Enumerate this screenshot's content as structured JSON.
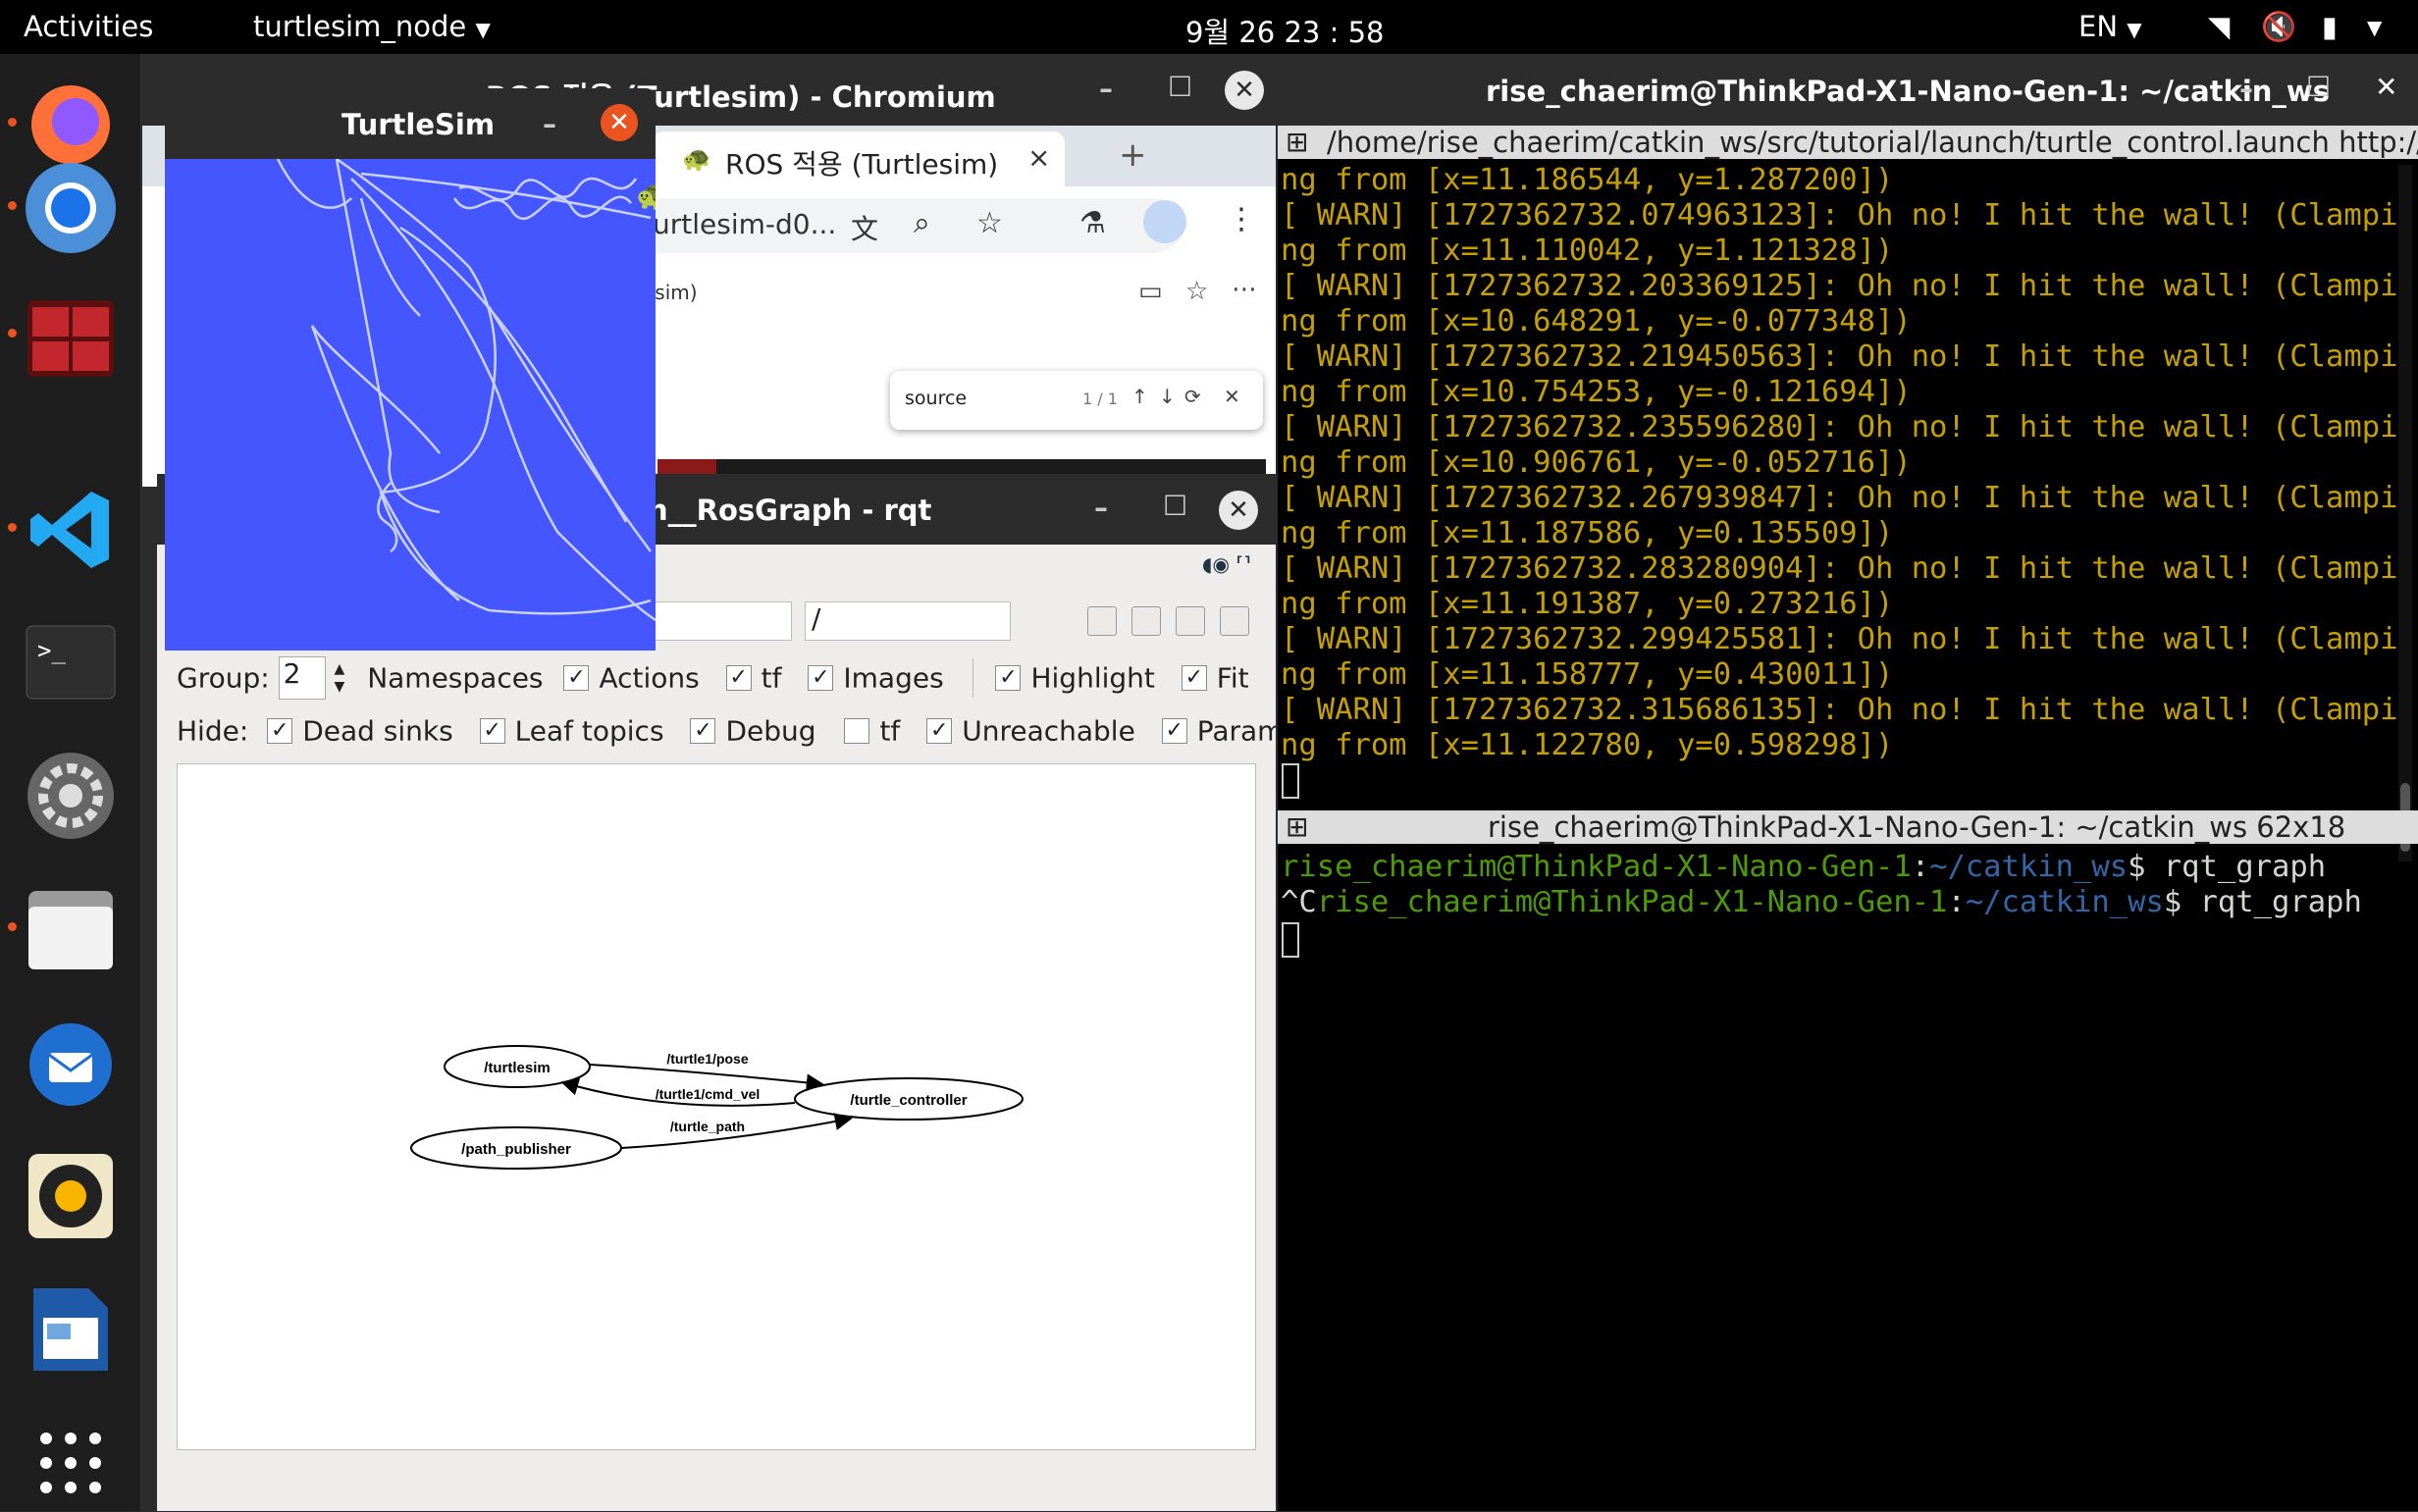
{
  "topbar": {
    "activities": "Activities",
    "app_menu": "turtlesim_node",
    "clock": "9월 26  23 : 58",
    "lang": "EN"
  },
  "dock": [
    "firefox-icon",
    "chromium-icon",
    "terminator-icon",
    "vscode-icon",
    "terminal-icon",
    "settings-icon",
    "files-icon",
    "thunderbird-icon",
    "rhythmbox-icon",
    "writer-icon",
    "show-apps-icon"
  ],
  "chromium": {
    "title": "ROS 적용 (Turtlesim) - Chromium",
    "tab": "ROS 적용 (Turtlesim)",
    "url": "urtlesim-d0...",
    "frag": "esim)",
    "find": {
      "query": "source",
      "count": "1 / 1"
    }
  },
  "turtlesim": {
    "title": "TurtleSim"
  },
  "rqt": {
    "title": "h__RosGraph - rqt",
    "filter2": "/",
    "group_label": "Group:",
    "group_value": "2",
    "namespaces": "Namespaces",
    "actions": "Actions",
    "tf": "tf",
    "images": "Images",
    "highlight": "Highlight",
    "fit": "Fit",
    "hide_label": "Hide:",
    "dead_sinks": "Dead sinks",
    "leaf_topics": "Leaf topics",
    "debug": "Debug",
    "tf2": "tf",
    "unreachable": "Unreachable",
    "params": "Params",
    "nodes": {
      "turtlesim": "/turtlesim",
      "controller": "/turtle_controller",
      "publisher": "/path_publisher"
    },
    "edges": {
      "pose": "/turtle1/pose",
      "cmd_vel": "/turtle1/cmd_vel",
      "path": "/turtle_path"
    }
  },
  "terminal": {
    "title": "rise_chaerim@ThinkPad-X1-Nano-Gen-1: ~/catkin_ws",
    "pane1_header": "/home/rise_chaerim/catkin_ws/src/tutorial/launch/turtle_control.launch http://loc",
    "log": [
      "ng from [x=11.186544, y=1.287200])",
      "[ WARN] [1727362732.074963123]: Oh no! I hit the wall! (Clampi",
      "ng from [x=11.110042, y=1.121328])",
      "[ WARN] [1727362732.203369125]: Oh no! I hit the wall! (Clampi",
      "ng from [x=10.648291, y=-0.077348])",
      "[ WARN] [1727362732.219450563]: Oh no! I hit the wall! (Clampi",
      "ng from [x=10.754253, y=-0.121694])",
      "[ WARN] [1727362732.235596280]: Oh no! I hit the wall! (Clampi",
      "ng from [x=10.906761, y=-0.052716])",
      "[ WARN] [1727362732.267939847]: Oh no! I hit the wall! (Clampi",
      "ng from [x=11.187586, y=0.135509])",
      "[ WARN] [1727362732.283280904]: Oh no! I hit the wall! (Clampi",
      "ng from [x=11.191387, y=0.273216])",
      "[ WARN] [1727362732.299425581]: Oh no! I hit the wall! (Clampi",
      "ng from [x=11.158777, y=0.430011])",
      "[ WARN] [1727362732.315686135]: Oh no! I hit the wall! (Clampi",
      "ng from [x=11.122780, y=0.598298])"
    ],
    "pane2_header": "rise_chaerim@ThinkPad-X1-Nano-Gen-1: ~/catkin_ws 62x18",
    "user": "rise_chaerim@ThinkPad-X1-Nano-Gen-1",
    "path": "~/catkin_ws",
    "cmd": "$ rqt_graph",
    "ctrlc": "^C"
  },
  "colors": {
    "turtle_bg": "#4556ff",
    "term_yellow": "#c4a000",
    "prompt_green": "#4e9a06",
    "prompt_blue": "#3465a4"
  }
}
